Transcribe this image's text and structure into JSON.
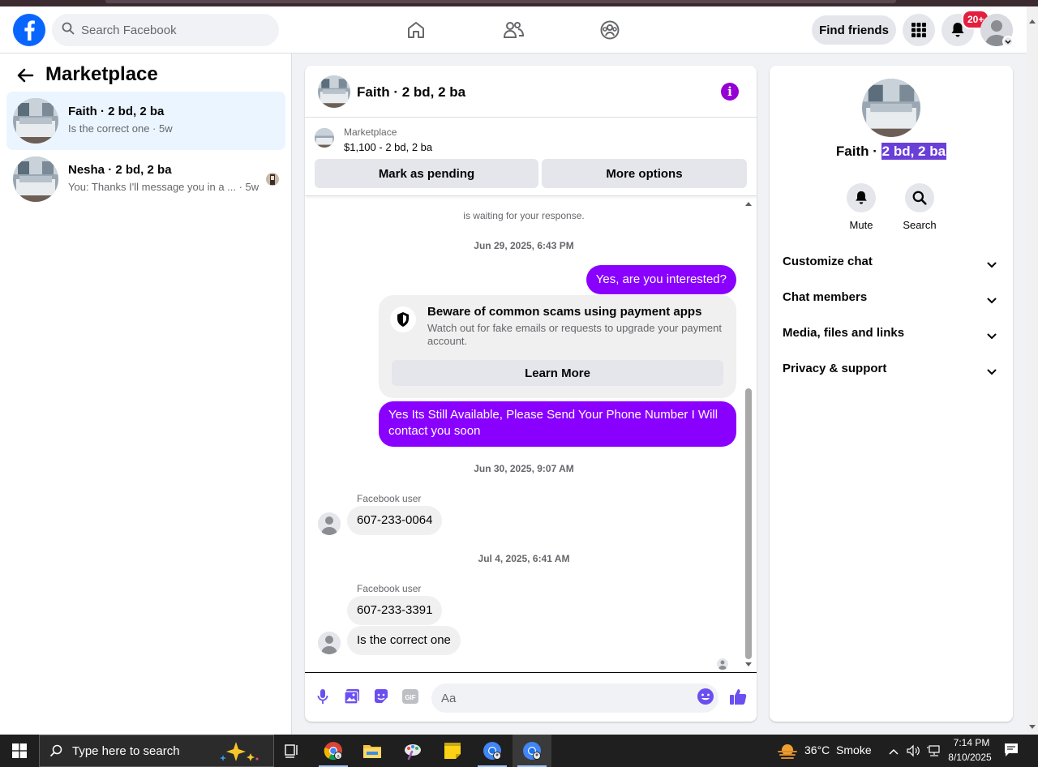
{
  "header": {
    "search_placeholder": "Search Facebook",
    "find_friends": "Find friends",
    "notification_badge": "20+"
  },
  "sidebar": {
    "title": "Marketplace",
    "conversations": [
      {
        "name": "Faith · 2 bd, 2 ba",
        "preview": "Is the correct one · 5w"
      },
      {
        "name": "Nesha · 2 bd, 2 ba",
        "preview": "You: Thanks I'll message you in a ... · 5w"
      }
    ]
  },
  "chat": {
    "title": "Faith · 2 bd, 2 ba",
    "listing_source": "Marketplace",
    "listing_price": "$1,100 - 2 bd, 2 ba",
    "mark_pending": "Mark as pending",
    "more_options": "More options",
    "system_note": "is waiting for your response.",
    "ts1": "Jun 29, 2025, 6:43 PM",
    "msg1": "Yes, are you interested?",
    "scam_title": "Beware of common scams using payment apps",
    "scam_desc": "Watch out for fake emails or requests to upgrade your payment account.",
    "learn_more": "Learn More",
    "msg2": "Yes Its Still Available, Please Send Your Phone Number I Will contact you soon",
    "ts2": "Jun 30, 2025, 9:07 AM",
    "sender1": "Facebook user",
    "msg3": "607-233-0064",
    "ts3": "Jul 4, 2025, 6:41 AM",
    "sender2": "Facebook user",
    "msg4": "607-233-3391",
    "msg5": "Is the correct one",
    "composer_placeholder": "Aa"
  },
  "details": {
    "name_prefix": "Faith · ",
    "name_highlight": "2 bd, 2 ba",
    "mute": "Mute",
    "search": "Search",
    "sections": [
      "Customize chat",
      "Chat members",
      "Media, files and links",
      "Privacy & support"
    ]
  },
  "taskbar": {
    "search_placeholder": "Type here to search",
    "weather": "36°C  Smoke",
    "time": "7:14 PM",
    "date": "8/10/2025"
  },
  "colors": {
    "accent": "#8a00ff",
    "fb_blue": "#0866ff",
    "info": "#9400d3"
  }
}
